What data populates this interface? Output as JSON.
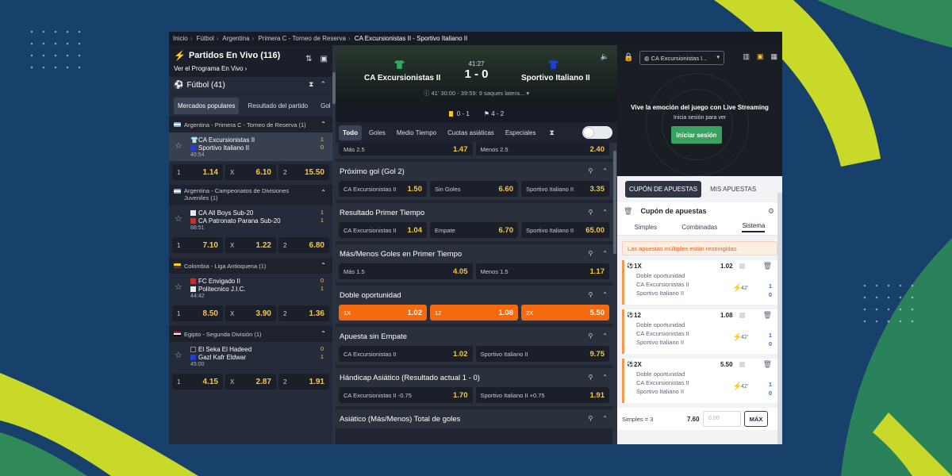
{
  "colors": {
    "accent_yellow": "#f7c744",
    "orange": "#f56a0c",
    "green": "#3aa25f",
    "bg_blue": "#17406b"
  },
  "breadcrumb": [
    "Inicio",
    "Fútbol",
    "Argentina",
    "Primera C - Torneo de Reserva",
    "CA Excursionistas II - Sportivo Italiano II"
  ],
  "left": {
    "title": "Partidos En Vivo (116)",
    "subtitle": "Ver el Programa En Vivo  ›",
    "sport": "Fútbol (41)",
    "tabs": [
      "Mercados populares",
      "Resultado del partido",
      "Gol"
    ],
    "leagues": [
      {
        "name": "Argentina - Primera C - Torneo de Reserva (1)",
        "flag": "argentina",
        "home": "CA Excursionistas II",
        "away": "Sportivo Italiano II",
        "time": "40:54",
        "hs": "1",
        "as": "0",
        "o1": "1.14",
        "ox": "6.10",
        "o2": "15.50"
      },
      {
        "name": "Argentina - Campeonatos de Divisiones Juveniles (1)",
        "flag": "argentina",
        "home": "CA All Boys Sub-20",
        "away": "CA Patronato Parana Sub-20",
        "time": "88:51",
        "hs": "1",
        "as": "1",
        "o1": "7.10",
        "ox": "1.22",
        "o2": "6.80"
      },
      {
        "name": "Colombia - Liga Antioquena (1)",
        "flag": "colombia",
        "home": "FC Envigado II",
        "away": "Politecnico J.I.C.",
        "time": "44:42",
        "hs": "0",
        "as": "1",
        "o1": "8.50",
        "ox": "3.90",
        "o2": "1.36"
      },
      {
        "name": "Egipto - Segunda División (1)",
        "flag": "egypt",
        "home": "El Seka El Hadeed",
        "away": "Gazl Kafr Eldwar",
        "time": "45:00",
        "hs": "0",
        "as": "1",
        "o1": "4.15",
        "ox": "2.87",
        "o2": "1.91"
      }
    ],
    "labels": {
      "one": "1",
      "x": "X",
      "two": "2"
    }
  },
  "scoreboard": {
    "clock": "41:27",
    "home": "CA  Excursionistas  II",
    "away": "Sportivo  Italiano  II",
    "score": "1 - 0",
    "info": "41'  30:00 - 39:59: 9 saques latera...",
    "cards": "0 - 1",
    "corners": "4 - 2"
  },
  "center_tabs": [
    "Todo",
    "Goles",
    "Medio Tiempo",
    "Cuotas asiáticas",
    "Especiales"
  ],
  "markets": [
    {
      "title": "",
      "rows": [
        [
          [
            "Más 2.5",
            "1.47"
          ],
          [
            "Menos 2.5",
            "2.40"
          ]
        ]
      ]
    },
    {
      "title": "Próximo gol (Gol 2)",
      "rows": [
        [
          [
            "CA Excursionistas II",
            "1.50"
          ],
          [
            "Sin Goles",
            "6.60"
          ],
          [
            "Sportivo Italiano II",
            "3.35"
          ]
        ]
      ]
    },
    {
      "title": "Resultado Primer Tiempo",
      "rows": [
        [
          [
            "CA Excursionistas II",
            "1.04"
          ],
          [
            "Empate",
            "6.70"
          ],
          [
            "Sportivo Italiano II",
            "65.00"
          ]
        ]
      ]
    },
    {
      "title": "Más/Menos Goles en Primer Tiempo",
      "rows": [
        [
          [
            "Más 1.5",
            "4.05"
          ],
          [
            "Menos 1.5",
            "1.17"
          ]
        ]
      ]
    },
    {
      "title": "Doble oportunidad",
      "selected": true,
      "rows": [
        [
          [
            "1X",
            "1.02"
          ],
          [
            "12",
            "1.08"
          ],
          [
            "2X",
            "5.50"
          ]
        ]
      ]
    },
    {
      "title": "Apuesta sin Empate",
      "rows": [
        [
          [
            "CA Excursionistas II",
            "1.02"
          ],
          [
            "Sportivo Italiano II",
            "9.75"
          ]
        ]
      ]
    },
    {
      "title": "Hándicap Asiático (Resultado actual 1 - 0)",
      "rows": [
        [
          [
            "CA Excursionistas II -0.75",
            "1.70"
          ],
          [
            "Sportivo Italiano II +0.75",
            "1.91"
          ]
        ]
      ]
    },
    {
      "title": "Asiático (Más/Menos) Total de goles",
      "rows": []
    }
  ],
  "stream": {
    "select": "CA Excursionistas I...",
    "message": "Vive la emoción del juego con Live Streaming",
    "message2": "Inicia sesión para ver",
    "login": "Iniciar sesión"
  },
  "betslip": {
    "tab_coupon": "CUPÓN DE APUESTAS",
    "tab_mine": "MIS APUESTAS",
    "title": "Cupón de apuestas",
    "types": [
      "Simples",
      "Combinadas",
      "Sistema"
    ],
    "warning": "Las apuestas múltiples están restringidas",
    "bets": [
      {
        "pick": "1X",
        "odd": "1.02",
        "market": "Doble oportunidad",
        "home": "CA Excursionistas II",
        "away": "Sportivo Italiano II",
        "minute": "42'",
        "hs": "1",
        "as": "0"
      },
      {
        "pick": "12",
        "odd": "1.08",
        "market": "Doble oportunidad",
        "home": "CA Excursionistas II",
        "away": "Sportivo Italiano II",
        "minute": "42'",
        "hs": "1",
        "as": "0"
      },
      {
        "pick": "2X",
        "odd": "5.50",
        "market": "Doble oportunidad",
        "home": "CA Excursionistas II",
        "away": "Sportivo Italiano II",
        "minute": "42'",
        "hs": "1",
        "as": "0"
      }
    ],
    "footer_label": "Simples = 3",
    "footer_value": "7.60",
    "stake_placeholder": "0.00",
    "max": "MÁX"
  }
}
